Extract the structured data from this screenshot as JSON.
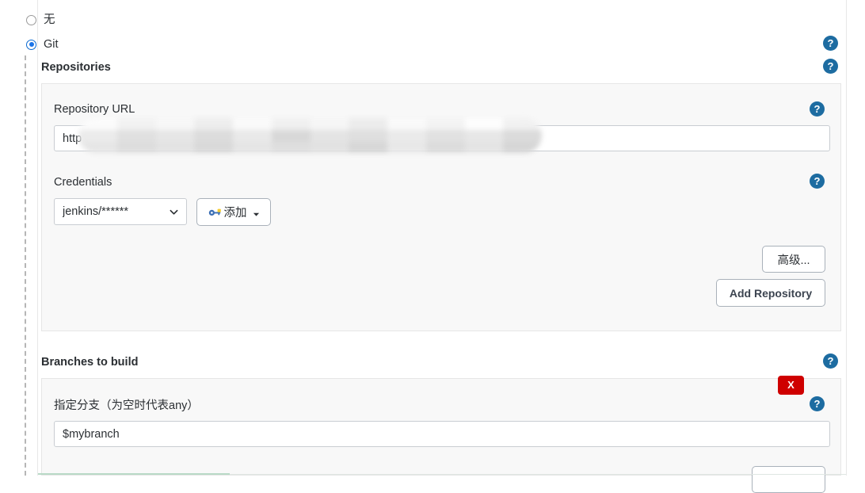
{
  "scm": {
    "options": [
      {
        "label": "无",
        "selected": false
      },
      {
        "label": "Git",
        "selected": true
      }
    ]
  },
  "repositories": {
    "section_label": "Repositories",
    "repository_url": {
      "label": "Repository URL",
      "value": "http",
      "redacted": true
    },
    "credentials": {
      "label": "Credentials",
      "selected": "jenkins/******",
      "add_button": "添加"
    },
    "advanced_button": "高级...",
    "add_repository_button": "Add Repository"
  },
  "branches": {
    "section_label": "Branches to build",
    "branch_specifier": {
      "label": "指定分支（为空时代表any）",
      "value": "$mybranch"
    },
    "delete_badge": "X"
  },
  "icons": {
    "help": "?",
    "help_name": "help-icon",
    "key_name": "key-icon",
    "chevron_name": "chevron-down-icon"
  },
  "colors": {
    "accent_blue": "#1a73e8",
    "help_blue": "#1d6ca1",
    "danger_red": "#cf0000",
    "panel_bg": "#f8f8f8",
    "panel_border": "#e6e6e6",
    "input_border": "#c9cdd2",
    "button_border": "#a9b1ba",
    "bottom_accent": "#b8d9c6"
  }
}
